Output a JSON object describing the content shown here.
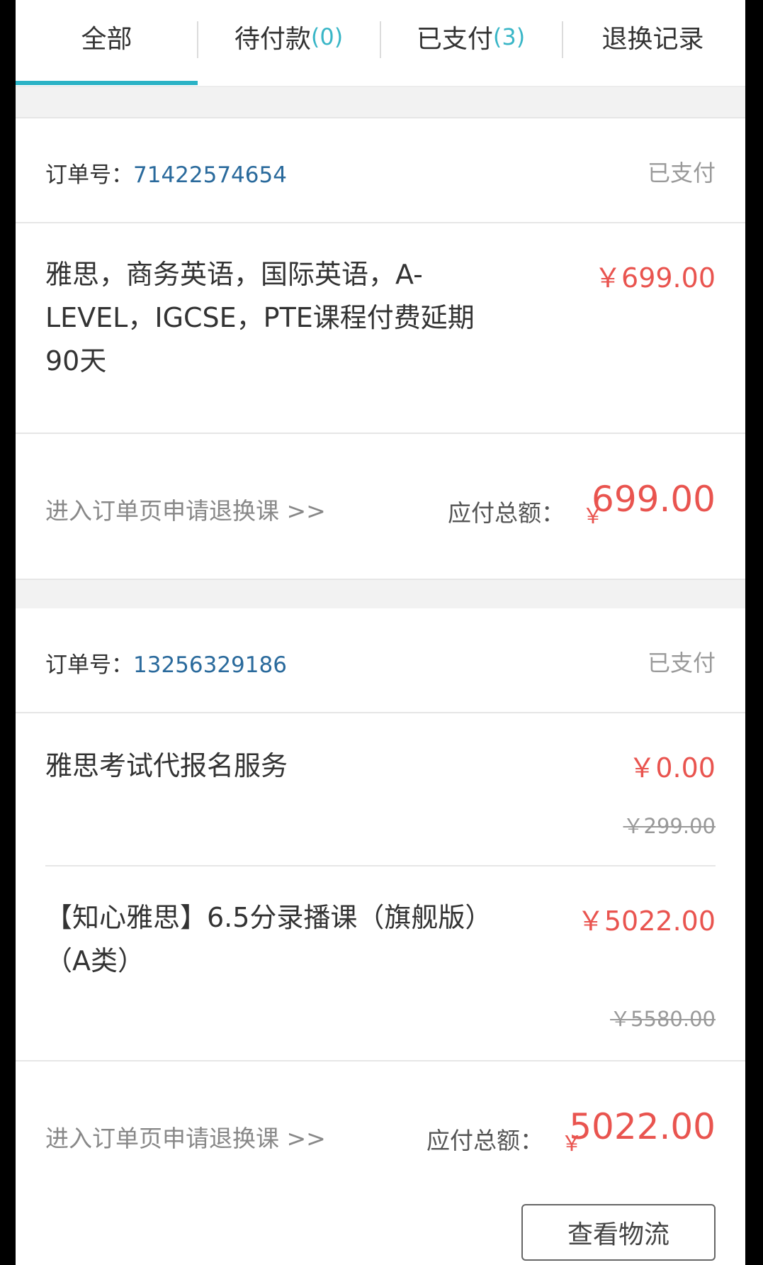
{
  "tabs": [
    {
      "label": "全部",
      "count": ""
    },
    {
      "label": "待付款",
      "count": "(0)"
    },
    {
      "label": "已支付",
      "count": "(3)"
    },
    {
      "label": "退换记录",
      "count": ""
    }
  ],
  "active_tab_index": 0,
  "accent_color": "#2bb3c6",
  "price_color": "#e9544f",
  "orders": [
    {
      "order_label": "订单号：",
      "order_number": "71422574654",
      "status": "已支付",
      "items": [
        {
          "title": "雅思，商务英语，国际英语，A-LEVEL，IGCSE，PTE课程付费延期90天",
          "price": "￥699.00",
          "original_price": ""
        }
      ],
      "refund_link": "进入订单页申请退换课 >>",
      "total_label": "应付总额：",
      "total_yen": "￥",
      "total_amount": "699.00"
    },
    {
      "order_label": "订单号：",
      "order_number": "13256329186",
      "status": "已支付",
      "items": [
        {
          "title": "雅思考试代报名服务",
          "price": "￥0.00",
          "original_price": "￥299.00"
        },
        {
          "title": "【知心雅思】6.5分录播课（旗舰版）（A类）",
          "price": "￥5022.00",
          "original_price": "￥5580.00"
        }
      ],
      "refund_link": "进入订单页申请退换课 >>",
      "total_label": "应付总额：",
      "total_yen": "￥",
      "total_amount": "5022.00",
      "logistics_button": "查看物流"
    }
  ]
}
